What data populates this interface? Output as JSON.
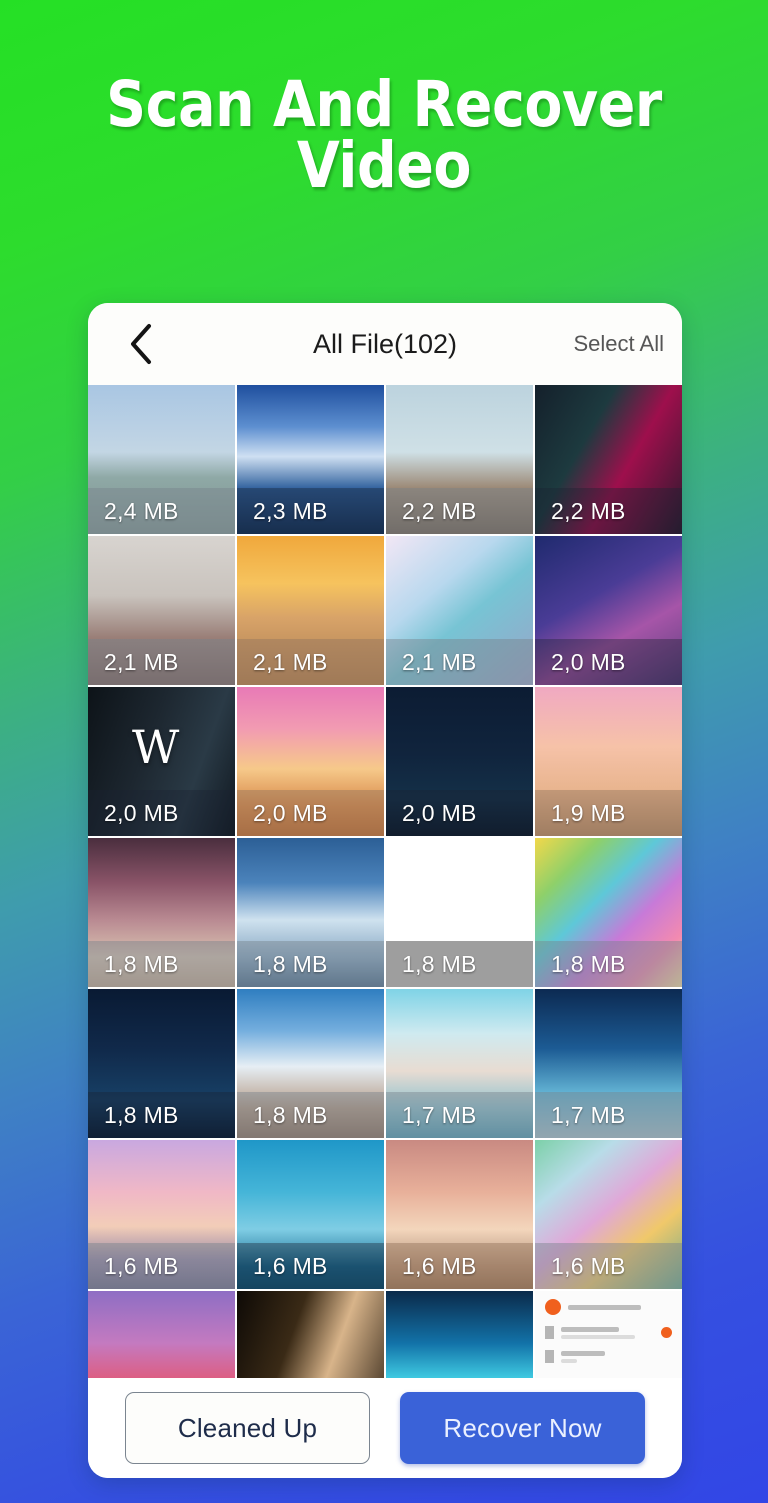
{
  "headline": "Scan And Recover\nVideo",
  "card": {
    "topbar": {
      "back_icon": "chevron-left-icon",
      "title": "All File(102)",
      "select_all": "Select All"
    },
    "grid": {
      "rows": [
        [
          {
            "size": "2,4 MB",
            "art": "a-sky-pale",
            "bar": "default"
          },
          {
            "size": "2,3 MB",
            "art": "a-sky-blue",
            "bar": "dark"
          },
          {
            "size": "2,2 MB",
            "art": "a-beach-girl",
            "bar": "default"
          },
          {
            "size": "2,2 MB",
            "art": "a-neon-girl",
            "bar": "dark"
          }
        ],
        [
          {
            "size": "2,1 MB",
            "art": "a-rose",
            "bar": "default"
          },
          {
            "size": "2,1 MB",
            "art": "a-sunset-couple",
            "bar": "warm"
          },
          {
            "size": "2,1 MB",
            "art": "a-galaxy-pastel",
            "bar": "default"
          },
          {
            "size": "2,0 MB",
            "art": "a-galaxy-deep",
            "bar": "dark"
          }
        ],
        [
          {
            "size": "2,0 MB",
            "art": "a-dark-w",
            "bar": "dark"
          },
          {
            "size": "2,0 MB",
            "art": "a-pink-sunset",
            "bar": "warm"
          },
          {
            "size": "2,0 MB",
            "art": "a-night-sky",
            "bar": "dark"
          },
          {
            "size": "1,9 MB",
            "art": "a-peach-sky",
            "bar": "warm"
          }
        ],
        [
          {
            "size": "1,8 MB",
            "art": "a-dark-cloud",
            "bar": "default"
          },
          {
            "size": "1,8 MB",
            "art": "a-blue-cloud",
            "bar": "default"
          },
          {
            "size": "1,8 MB",
            "art": "a-white",
            "bar": "grey"
          },
          {
            "size": "1,8 MB",
            "art": "a-rainbow",
            "bar": "default"
          }
        ],
        [
          {
            "size": "1,8 MB",
            "art": "a-deep-navy",
            "bar": "dark"
          },
          {
            "size": "1,8 MB",
            "art": "a-cloud-sea",
            "bar": "default"
          },
          {
            "size": "1,7 MB",
            "art": "a-girl-sea",
            "bar": "default"
          },
          {
            "size": "1,7 MB",
            "art": "a-blue-grad",
            "bar": "default"
          }
        ],
        [
          {
            "size": "1,6 MB",
            "art": "a-pastel-sea",
            "bar": "default"
          },
          {
            "size": "1,6 MB",
            "art": "a-cyan-sky",
            "bar": "dark"
          },
          {
            "size": "1,6 MB",
            "art": "a-warm-sky",
            "bar": "warm"
          },
          {
            "size": "1,6 MB",
            "art": "a-rainbow-cloud",
            "bar": "default"
          }
        ],
        [
          {
            "size": "",
            "art": "a-purple-cloud",
            "bar": "none"
          },
          {
            "size": "",
            "art": "a-gold-girl",
            "bar": "none"
          },
          {
            "size": "",
            "art": "a-earth",
            "bar": "none"
          },
          {
            "size": "",
            "art": "a-screenshot",
            "bar": "none"
          }
        ]
      ]
    },
    "actions": {
      "cleaned_up": "Cleaned Up",
      "recover_now": "Recover Now"
    }
  },
  "colors": {
    "bg_top": "#2ee02e",
    "bg_mid": "#3f9cad",
    "bg_bottom": "#3246e6",
    "primary_button": "#3a62d8",
    "outline_button_text": "#1e2c4a"
  }
}
